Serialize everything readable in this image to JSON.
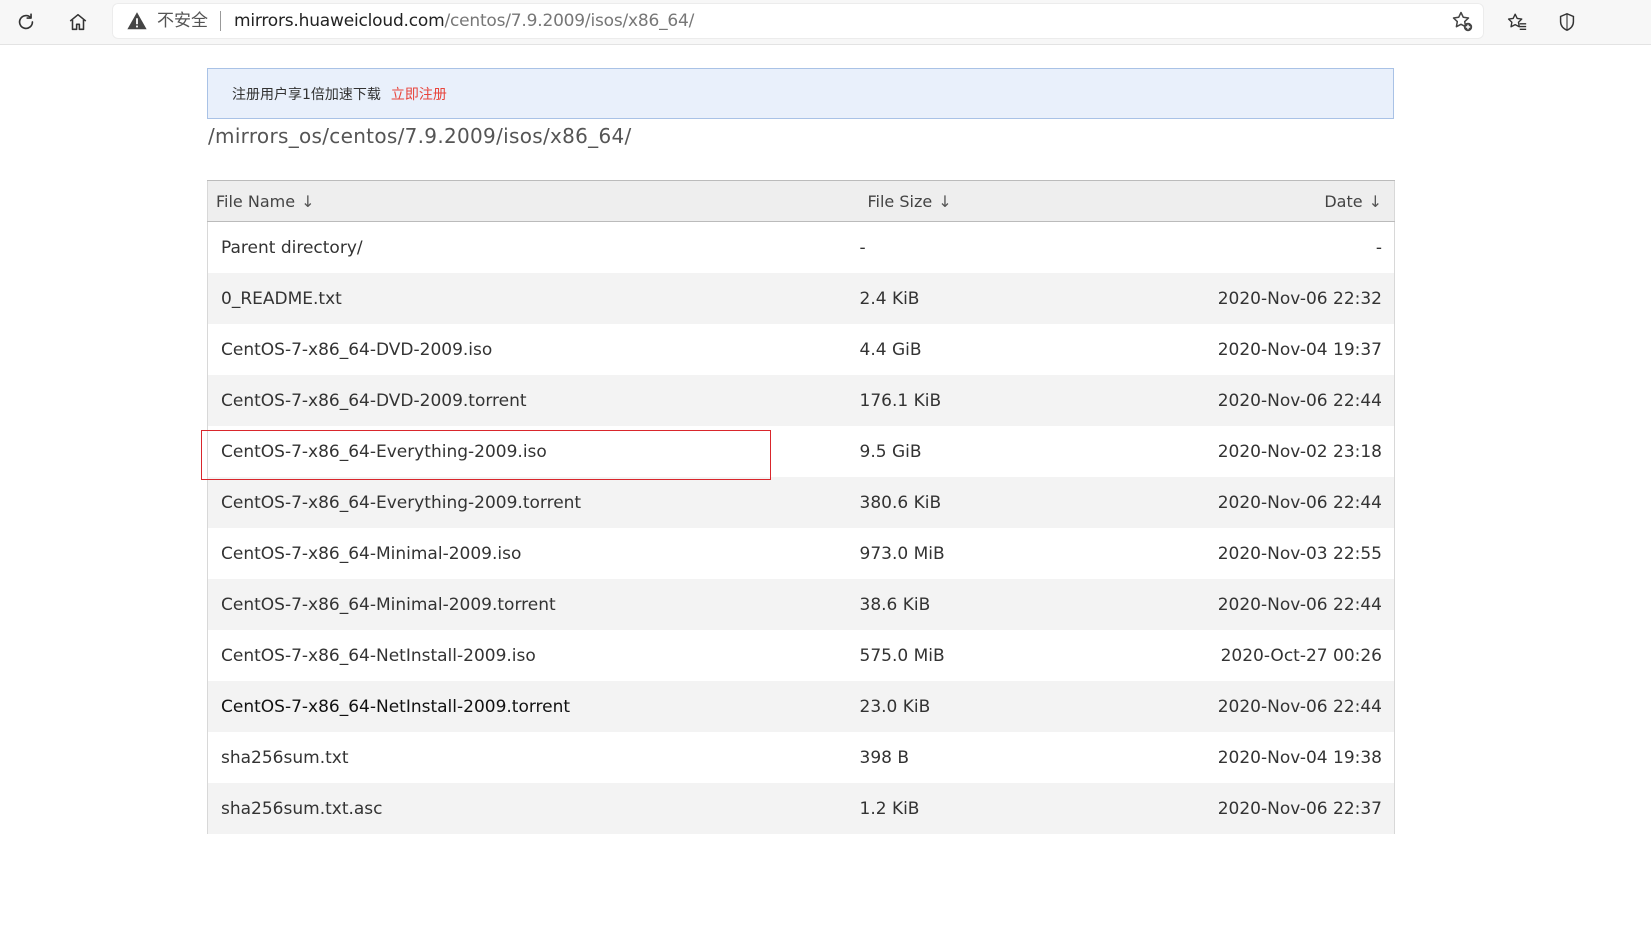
{
  "browser": {
    "insecure_label": "不安全",
    "url_host": "mirrors.huaweicloud.com",
    "url_path": "/centos/7.9.2009/isos/x86_64/"
  },
  "notice": {
    "text": "注册用户享1倍加速下载",
    "link": "立即注册",
    "link_color": "#e8453c"
  },
  "breadcrumb": "/mirrors_os/centos/7.9.2009/isos/x86_64/",
  "table": {
    "headers": {
      "name": "File Name",
      "size": "File Size",
      "date": "Date",
      "sort_glyph": "↓"
    },
    "rows": [
      {
        "name": "Parent directory/",
        "size": "-",
        "date": "-"
      },
      {
        "name": "0_README.txt",
        "size": "2.4 KiB",
        "date": "2020-Nov-06 22:32"
      },
      {
        "name": "CentOS-7-x86_64-DVD-2009.iso",
        "size": "4.4 GiB",
        "date": "2020-Nov-04 19:37"
      },
      {
        "name": "CentOS-7-x86_64-DVD-2009.torrent",
        "size": "176.1 KiB",
        "date": "2020-Nov-06 22:44"
      },
      {
        "name": "CentOS-7-x86_64-Everything-2009.iso",
        "size": "9.5 GiB",
        "date": "2020-Nov-02 23:18"
      },
      {
        "name": "CentOS-7-x86_64-Everything-2009.torrent",
        "size": "380.6 KiB",
        "date": "2020-Nov-06 22:44"
      },
      {
        "name": "CentOS-7-x86_64-Minimal-2009.iso",
        "size": "973.0 MiB",
        "date": "2020-Nov-03 22:55"
      },
      {
        "name": "CentOS-7-x86_64-Minimal-2009.torrent",
        "size": "38.6 KiB",
        "date": "2020-Nov-06 22:44"
      },
      {
        "name": "CentOS-7-x86_64-NetInstall-2009.iso",
        "size": "575.0 MiB",
        "date": "2020-Oct-27 00:26"
      },
      {
        "name": "CentOS-7-x86_64-NetInstall-2009.torrent",
        "size": "23.0 KiB",
        "date": "2020-Nov-06 22:44"
      },
      {
        "name": "sha256sum.txt",
        "size": "398 B",
        "date": "2020-Nov-04 19:38"
      },
      {
        "name": "sha256sum.txt.asc",
        "size": "1.2 KiB",
        "date": "2020-Nov-06 22:37"
      }
    ]
  },
  "annotation": {
    "highlight_color": "#d9262c",
    "highlighted_row": "CentOS-7-x86_64-Everything-2009.iso"
  },
  "icons": [
    "refresh-icon",
    "home-icon",
    "warning-icon",
    "add-favorite-icon",
    "favorites-icon",
    "shield-icon"
  ]
}
